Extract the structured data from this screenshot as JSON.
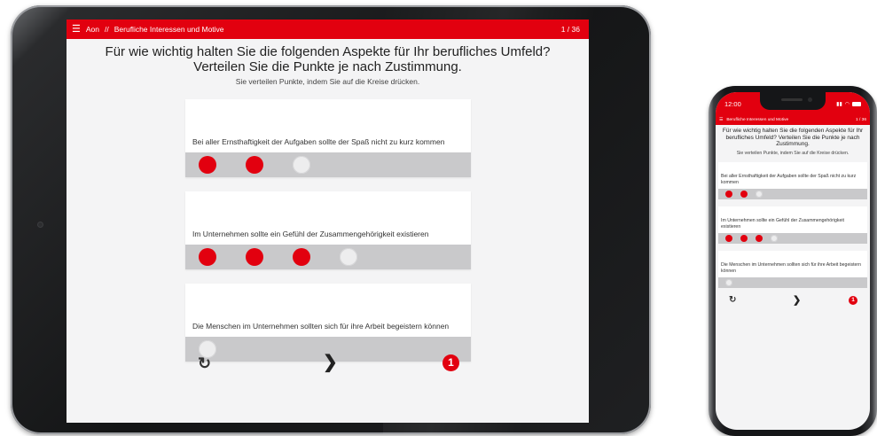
{
  "colors": {
    "accent": "#e2000f",
    "card_bar": "#c9c9cb",
    "dot_empty": "#ededee",
    "screen_bg": "#f4f4f5"
  },
  "tablet": {
    "header": {
      "menu_icon": "hamburger-icon",
      "brand": "Aon",
      "separator": "//",
      "section": "Berufliche Interessen und Motive",
      "counter": "1 / 36"
    },
    "title": "Für wie wichtig halten Sie die folgenden Aspekte für Ihr berufliches Umfeld? Verteilen Sie die Punkte je nach Zustimmung.",
    "subtitle": "Sie verteilen Punkte, indem Sie auf die Kreise drücken.",
    "items": [
      {
        "text": "Bei aller Ernsthaftigkeit der Aufgaben sollte der Spaß nicht zu kurz kommen",
        "filled": 2,
        "shown": 3
      },
      {
        "text": "Im Unternehmen sollte ein Gefühl der Zusammengehörigkeit existieren",
        "filled": 3,
        "shown": 4
      },
      {
        "text": "Die Menschen im Unternehmen sollten sich für ihre Arbeit begeistern können",
        "filled": 0,
        "shown": 1
      }
    ],
    "nav": {
      "reset_icon": "refresh-icon",
      "reset_glyph": "↻",
      "next_icon": "chevron-right-icon",
      "next_glyph": "❯",
      "remaining_points": "1"
    }
  },
  "phone": {
    "status": {
      "time": "12:00",
      "signal_icon": "signal-icon",
      "wifi_icon": "wifi-icon",
      "battery_icon": "battery-icon"
    },
    "header": {
      "menu_icon": "hamburger-icon",
      "section": "Berufliche Interessen und Motive",
      "counter": "1 / 36"
    },
    "title": "Für wie wichtig halten Sie die folgenden Aspekte für Ihr berufliches Umfeld? Verteilen Sie die Punkte je nach Zustimmung.",
    "subtitle": "Sie verteilen Punkte, indem Sie auf die Kreise drücken.",
    "items": [
      {
        "text": "Bei aller Ernsthaftigkeit der Aufgaben sollte der Spaß nicht zu kurz kommen",
        "filled": 2,
        "shown": 3
      },
      {
        "text": "Im Unternehmen sollte ein Gefühl der Zusammengehörigkeit existieren",
        "filled": 3,
        "shown": 4
      },
      {
        "text": "Die Menschen im Unternehmen sollten sich für ihre Arbeit begeistern können",
        "filled": 0,
        "shown": 1
      }
    ],
    "nav": {
      "reset_glyph": "↻",
      "next_glyph": "❯",
      "remaining_points": "1"
    }
  }
}
